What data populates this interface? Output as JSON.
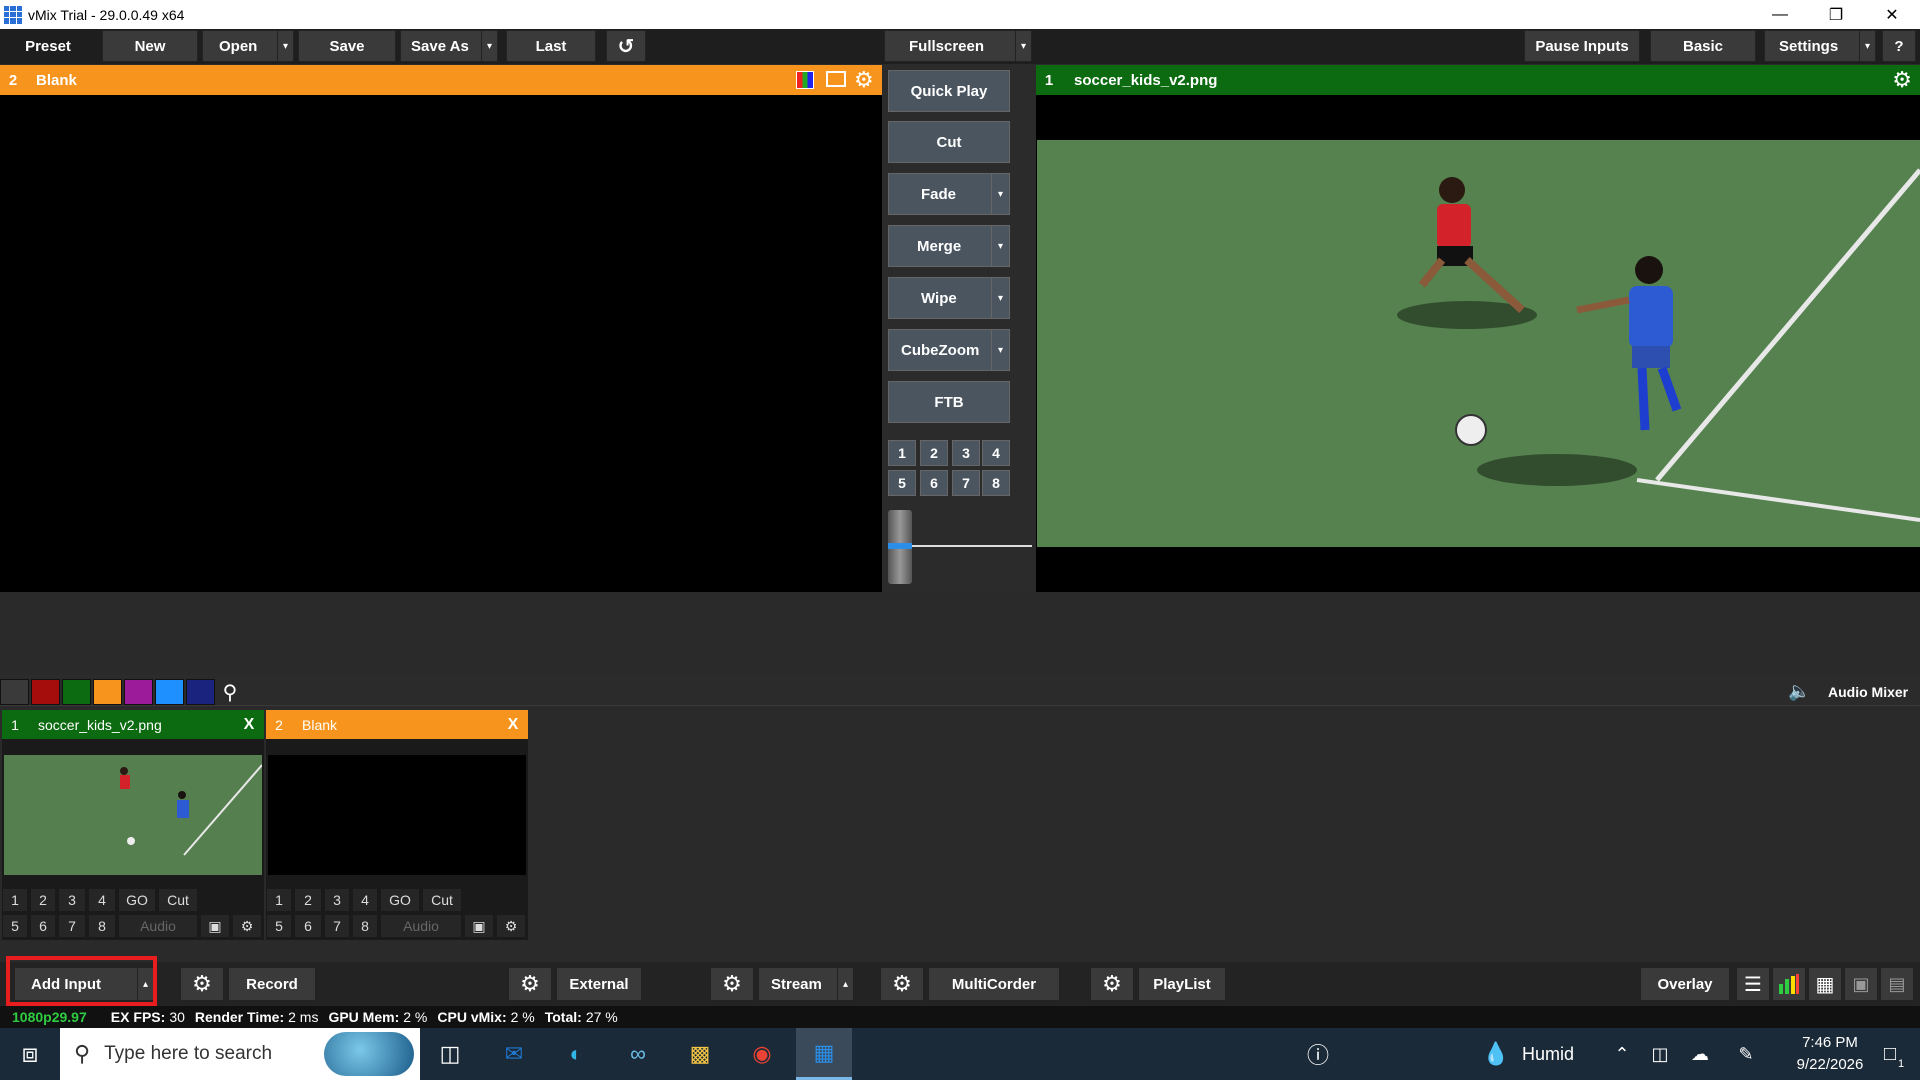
{
  "window": {
    "title": "vMix Trial - 29.0.0.49 x64"
  },
  "toolbar": {
    "preset": "Preset",
    "new": "New",
    "open": "Open",
    "save": "Save",
    "save_as": "Save As",
    "last": "Last",
    "fullscreen": "Fullscreen",
    "pause_inputs": "Pause Inputs",
    "basic": "Basic",
    "settings": "Settings",
    "help": "?"
  },
  "preview": {
    "number": "2",
    "title": "Blank",
    "color": "#f7941d"
  },
  "output": {
    "number": "1",
    "title": "soccer_kids_v2.png",
    "color": "#0c6a10"
  },
  "transitions": {
    "quick_play": "Quick Play",
    "cut": "Cut",
    "fade": "Fade",
    "merge": "Merge",
    "wipe": "Wipe",
    "cubezoom": "CubeZoom",
    "ftb": "FTB",
    "quick_numbers": [
      "1",
      "2",
      "3",
      "4",
      "5",
      "6",
      "7",
      "8"
    ]
  },
  "colorbar": [
    "#3a3a3a",
    "#a50d0d",
    "#0c6a10",
    "#f7941d",
    "#9b1b9b",
    "#1e90ff",
    "#1a237e"
  ],
  "audio_mixer": "Audio Mixer",
  "inputs": [
    {
      "number": "1",
      "title": "soccer_kids_v2.png",
      "close": "X",
      "color": "#0c6a10"
    },
    {
      "number": "2",
      "title": "Blank",
      "close": "X",
      "color": "#f7941d"
    }
  ],
  "input_controls": {
    "row1": [
      "1",
      "2",
      "3",
      "4",
      "GO",
      "Cut"
    ],
    "row2": [
      "5",
      "6",
      "7",
      "8"
    ],
    "audio": "Audio"
  },
  "bottom": {
    "add_input": "Add Input",
    "record": "Record",
    "external": "External",
    "stream": "Stream",
    "multicorder": "MultiCorder",
    "playlist": "PlayList",
    "overlay": "Overlay"
  },
  "status": {
    "format": "1080p29.97",
    "ex": "EX",
    "fps_label": "FPS:",
    "fps": "30",
    "render_label": "Render Time:",
    "render": "2 ms",
    "gpu_label": "GPU Mem:",
    "gpu": "2 %",
    "cpu_label": "CPU vMix:",
    "cpu": "2 %",
    "total_label": "Total:",
    "total": "27 %"
  },
  "taskbar": {
    "search_placeholder": "Type here to search",
    "weather": "Humid",
    "time": "7:46 PM",
    "date": "9/22/2026",
    "notification_count": "1"
  }
}
